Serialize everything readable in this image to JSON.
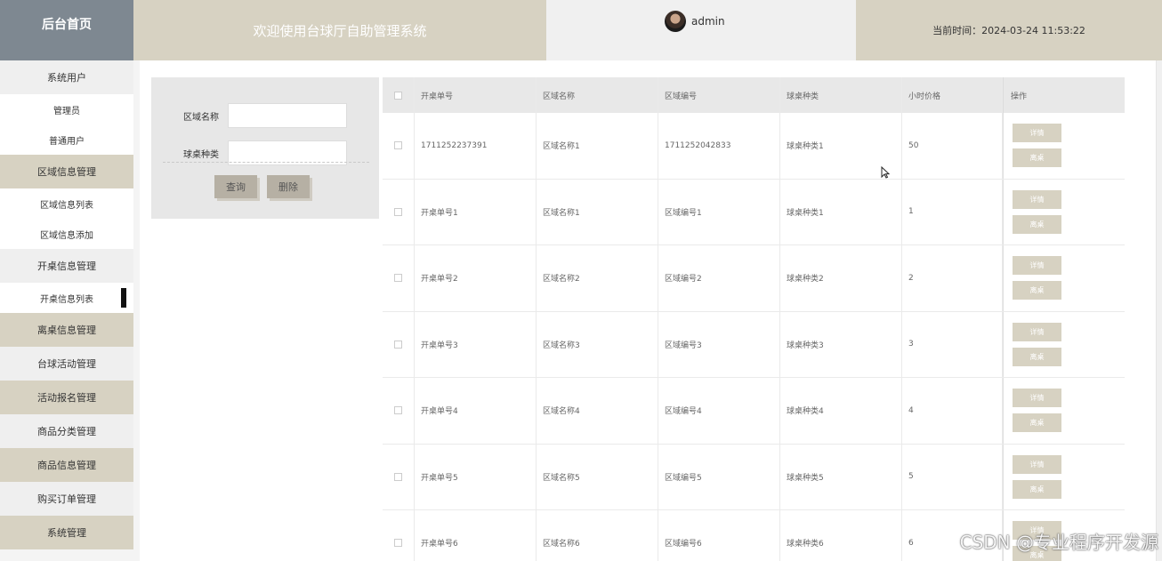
{
  "header": {
    "logo": "后台首页",
    "welcome": "欢迎使用台球厅自助管理系统",
    "username": "admin",
    "time_label": "当前时间：2024-03-24 11:53:22"
  },
  "sidebar": {
    "items": [
      {
        "label": "系统用户",
        "style": "light"
      },
      {
        "label": "管理员",
        "style": "sub"
      },
      {
        "label": "普通用户",
        "style": "sub"
      },
      {
        "label": "区域信息管理",
        "style": "tan"
      },
      {
        "label": "区域信息列表",
        "style": "sub"
      },
      {
        "label": "区域信息添加",
        "style": "sub"
      },
      {
        "label": "开桌信息管理",
        "style": "light"
      },
      {
        "label": "开桌信息列表",
        "style": "sub",
        "active": true
      },
      {
        "label": "离桌信息管理",
        "style": "tan"
      },
      {
        "label": "台球活动管理",
        "style": "light"
      },
      {
        "label": "活动报名管理",
        "style": "tan"
      },
      {
        "label": "商品分类管理",
        "style": "light"
      },
      {
        "label": "商品信息管理",
        "style": "tan"
      },
      {
        "label": "购买订单管理",
        "style": "light"
      },
      {
        "label": "系统管理",
        "style": "tan"
      }
    ]
  },
  "search": {
    "area_name_label": "区域名称",
    "table_type_label": "球桌种类",
    "area_name_value": "",
    "table_type_value": "",
    "query_button": "查询",
    "delete_button": "删除"
  },
  "table": {
    "headers": [
      "开桌单号",
      "区域名称",
      "区域编号",
      "球桌种类",
      "小时价格",
      "操作"
    ],
    "detail_button": "详情",
    "leave_button": "离桌",
    "rows": [
      {
        "order_no": "1711252237391",
        "area_name": "区域名称1",
        "area_code": "1711252042833",
        "table_type": "球桌种类1",
        "hourly_price": "50"
      },
      {
        "order_no": "开桌单号1",
        "area_name": "区域名称1",
        "area_code": "区域编号1",
        "table_type": "球桌种类1",
        "hourly_price": "1"
      },
      {
        "order_no": "开桌单号2",
        "area_name": "区域名称2",
        "area_code": "区域编号2",
        "table_type": "球桌种类2",
        "hourly_price": "2"
      },
      {
        "order_no": "开桌单号3",
        "area_name": "区域名称3",
        "area_code": "区域编号3",
        "table_type": "球桌种类3",
        "hourly_price": "3"
      },
      {
        "order_no": "开桌单号4",
        "area_name": "区域名称4",
        "area_code": "区域编号4",
        "table_type": "球桌种类4",
        "hourly_price": "4"
      },
      {
        "order_no": "开桌单号5",
        "area_name": "区域名称5",
        "area_code": "区域编号5",
        "table_type": "球桌种类5",
        "hourly_price": "5"
      },
      {
        "order_no": "开桌单号6",
        "area_name": "区域名称6",
        "area_code": "区域编号6",
        "table_type": "球桌种类6",
        "hourly_price": "6"
      }
    ]
  },
  "watermark": "CSDN @专业程序开发源"
}
